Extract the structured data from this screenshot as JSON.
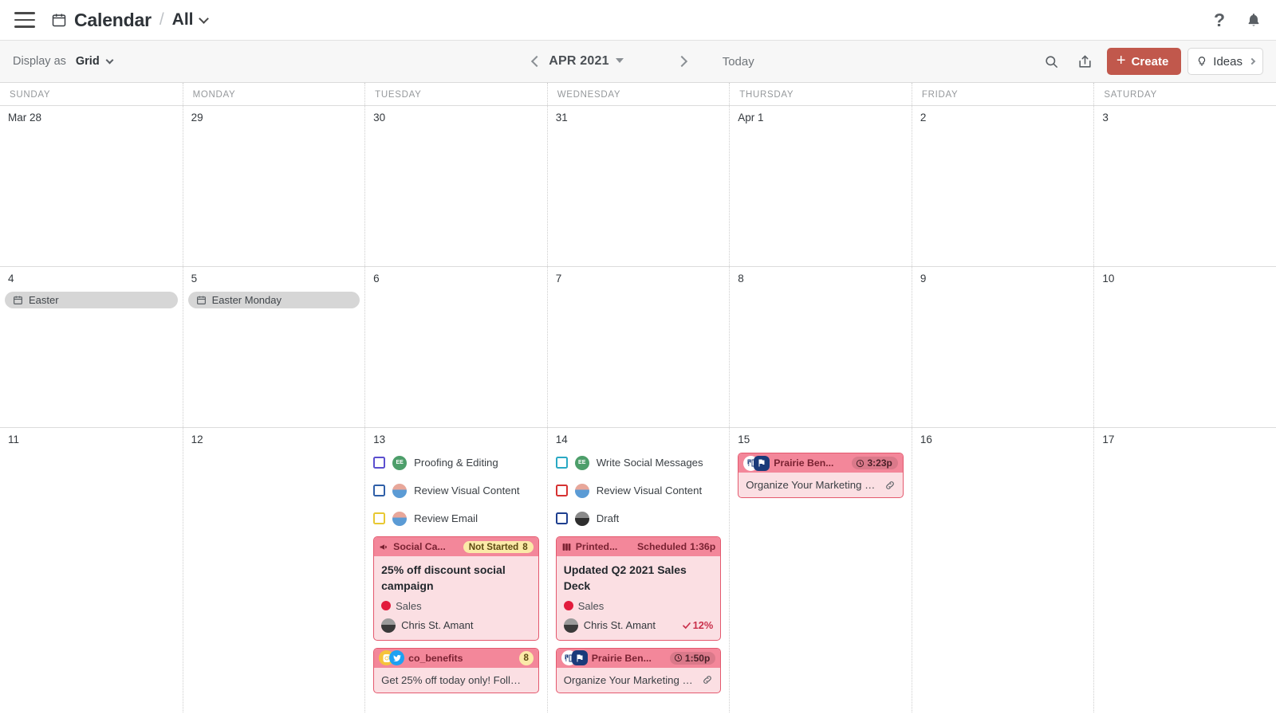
{
  "appbar": {
    "menu_icon": "hamburger-icon",
    "app_icon": "calendar-icon",
    "title": "Calendar",
    "separator": "/",
    "workspace": "All",
    "help_label": "?",
    "bell_icon": "bell-icon"
  },
  "toolbar": {
    "display_as_label": "Display as",
    "display_as_value": "Grid",
    "prev_label": "previous-period",
    "month_label": "APR 2021",
    "next_label": "next-period",
    "today_label": "Today",
    "search_icon": "search-icon",
    "share_icon": "share-icon",
    "create_label": "Create",
    "create_color": "#c1584c",
    "ideas_label": "Ideas"
  },
  "calendar": {
    "weekdays": [
      "SUNDAY",
      "MONDAY",
      "TUESDAY",
      "WEDNESDAY",
      "THURSDAY",
      "FRIDAY",
      "SATURDAY"
    ],
    "weeks": [
      {
        "days": [
          {
            "num": "Mar 28"
          },
          {
            "num": "29"
          },
          {
            "num": "30"
          },
          {
            "num": "31"
          },
          {
            "num": "Apr 1"
          },
          {
            "num": "2"
          },
          {
            "num": "3"
          }
        ]
      },
      {
        "days": [
          {
            "num": "4",
            "holiday": "Easter"
          },
          {
            "num": "5",
            "holiday": "Easter Monday"
          },
          {
            "num": "6"
          },
          {
            "num": "7"
          },
          {
            "num": "8"
          },
          {
            "num": "9"
          },
          {
            "num": "10"
          }
        ]
      },
      {
        "days": [
          {
            "num": "11"
          },
          {
            "num": "12"
          },
          {
            "num": "13"
          },
          {
            "num": "14"
          },
          {
            "num": "15"
          },
          {
            "num": "16"
          },
          {
            "num": "17"
          }
        ]
      }
    ]
  },
  "day13": {
    "tasks": [
      {
        "label": "Proofing & Editing",
        "checkbox_color": "#5b4fcf",
        "avatar": "EE",
        "avatar_color": "#4d9e6a"
      },
      {
        "label": "Review Visual Content",
        "checkbox_color": "#2f5fa8",
        "avatar": "photo",
        "avatar_color": "#8aa8c8"
      },
      {
        "label": "Review Email",
        "checkbox_color": "#e8c832",
        "avatar": "photo",
        "avatar_color": "#8aa8c8"
      }
    ],
    "campaign_card": {
      "channel": "Social Ca...",
      "channel_icon": "megaphone-icon",
      "status": "Not Started",
      "status_count": "8",
      "title": "25% off discount social campaign",
      "tag": "Sales",
      "tag_color": "#e21b3c",
      "person": "Chris St. Amant"
    },
    "social_card": {
      "account": "co_benefits",
      "count": "8",
      "icons": [
        "instagram-icon",
        "twitter-icon"
      ],
      "text": "Get 25% off today only! Foll…"
    }
  },
  "day14": {
    "tasks": [
      {
        "label": "Write Social Messages",
        "checkbox_color": "#2aa9c4",
        "avatar": "EE",
        "avatar_color": "#4d9e6a"
      },
      {
        "label": "Review Visual Content",
        "checkbox_color": "#d63232",
        "avatar": "photo",
        "avatar_color": "#8aa8c8"
      },
      {
        "label": "Draft",
        "checkbox_color": "#1e3f8f",
        "avatar": "photo",
        "avatar_color": "#6a6a6a"
      }
    ],
    "deck_card": {
      "channel": "Printed...",
      "channel_icon": "book-icon",
      "status": "Scheduled",
      "time": "1:36p",
      "title": "Updated Q2 2021 Sales Deck",
      "tag": "Sales",
      "tag_color": "#e21b3c",
      "person": "Chris St. Amant",
      "progress": "12%"
    },
    "social_card": {
      "account": "Prairie Ben...",
      "time": "1:50p",
      "icons": [
        "linkedin-icon",
        "flag-icon"
      ],
      "text": "Organize Your Marketing …",
      "link_icon": "link-icon"
    }
  },
  "day15": {
    "social_card": {
      "account": "Prairie Ben...",
      "time": "3:23p",
      "icons": [
        "linkedin-icon",
        "flag-icon"
      ],
      "text": "Organize Your Marketing …",
      "link_icon": "link-icon"
    }
  }
}
